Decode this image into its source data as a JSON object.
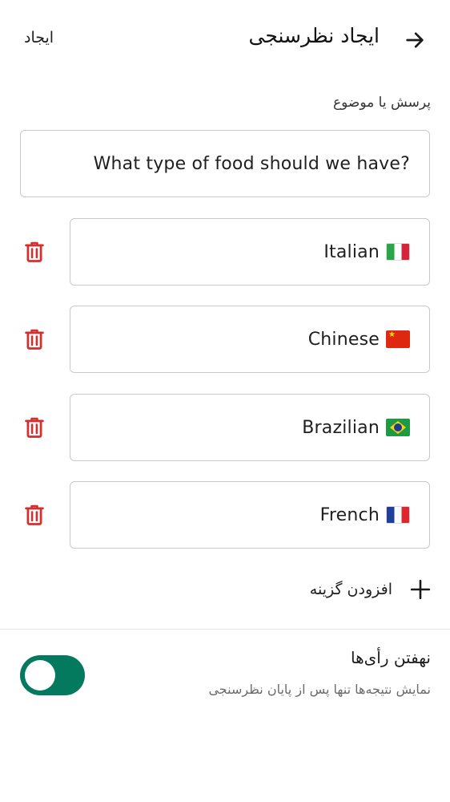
{
  "header": {
    "back_icon": "arrow-right-icon",
    "title": "ایجاد نظرسنجی",
    "create_label": "ایجاد"
  },
  "question": {
    "label": "پرسش یا موضوع",
    "value": "What type of food should we have?"
  },
  "options": [
    {
      "label": "Italian",
      "flag": "flag-italy"
    },
    {
      "label": "Chinese",
      "flag": "flag-china"
    },
    {
      "label": "Brazilian",
      "flag": "flag-brazil"
    },
    {
      "label": "French",
      "flag": "flag-france"
    }
  ],
  "delete_icon": "trash-icon",
  "add_option": {
    "icon": "plus-icon",
    "label": "افزودن گزینه"
  },
  "hide_votes": {
    "title": "نهفتن رأی‌ها",
    "subtitle": "نمایش نتیجه‌ها تنها پس از پایان نظرسنجی",
    "enabled": true
  },
  "colors": {
    "accent_green": "#037a5d",
    "delete_red": "#d32f2f",
    "border": "#c9c9cc"
  }
}
